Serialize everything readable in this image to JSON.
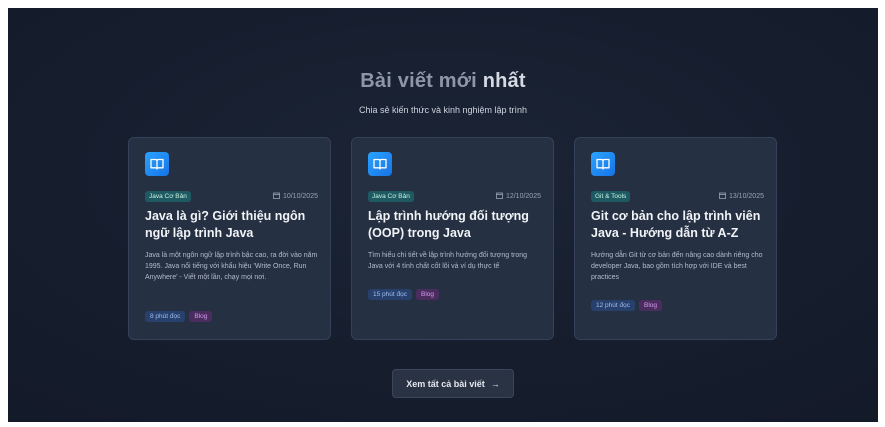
{
  "section": {
    "title_prefix": "Bài viết mới ",
    "title_accent": "nhất",
    "subtitle": "Chia sẻ kiến thức và kinh nghiệm lập trình"
  },
  "posts": [
    {
      "icon": "book-icon",
      "category": "Java Cơ Bản",
      "date": "10/10/2025",
      "title": "Java là gì? Giới thiệu ngôn ngữ lập trình Java",
      "description": "Java là một ngôn ngữ lập trình bậc cao, ra đời vào năm 1995. Java nổi tiếng với khẩu hiệu 'Write Once, Run Anywhere' - Viết một lần, chạy mọi nơi.",
      "read_time": "8 phút đọc",
      "tag": "Blog"
    },
    {
      "icon": "book-icon",
      "category": "Java Cơ Bản",
      "date": "12/10/2025",
      "title": "Lập trình hướng đối tượng (OOP) trong Java",
      "description": "Tìm hiểu chi tiết về lập trình hướng đối tượng trong Java với 4 tính chất cốt lõi và ví dụ thực tế",
      "read_time": "15 phút đọc",
      "tag": "Blog"
    },
    {
      "icon": "book-icon",
      "category": "Git & Tools",
      "date": "13/10/2025",
      "title": "Git cơ bản cho lập trình viên Java - Hướng dẫn từ A-Z",
      "description": "Hướng dẫn Git từ cơ bản đến nâng cao dành riêng cho developer Java, bao gồm tích hợp với IDE và best practices",
      "read_time": "12 phút đọc",
      "tag": "Blog"
    }
  ],
  "view_all": {
    "label": "Xem tất cả bài viết",
    "arrow": "→"
  },
  "colors": {
    "background": "#141b2a",
    "card": "#253042",
    "icon_gradient_start": "#2aa3ff",
    "icon_gradient_end": "#1773e6",
    "category_bg": "#1f5a63",
    "read_tag_bg": "#28406c",
    "blog_tag_bg": "#4a2d5e"
  }
}
